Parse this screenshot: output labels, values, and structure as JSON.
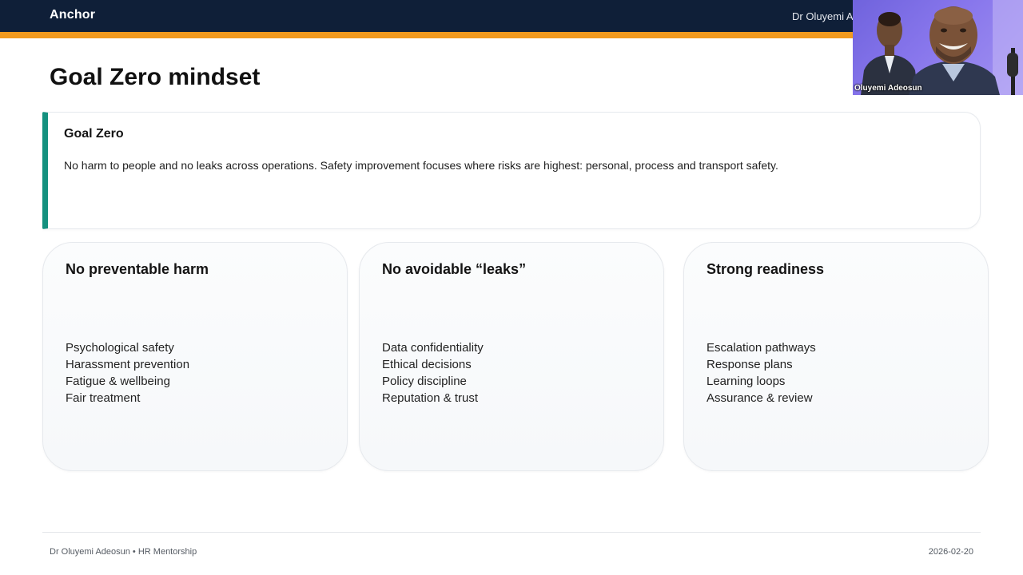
{
  "header": {
    "brand": "Anchor",
    "presenter": "Dr Oluyemi Adeosun",
    "colors": {
      "bar": "#0f1f38",
      "accent": "#f29a1e",
      "highlight": "#14917f"
    }
  },
  "slide": {
    "title": "Goal Zero mindset",
    "goal": {
      "heading": "Goal Zero",
      "text": "No harm to people and no leaks across operations. Safety improvement focuses where risks are highest: personal, process and transport safety."
    },
    "cards": [
      {
        "title": "No preventable harm",
        "items": [
          "Psychological safety",
          "Harassment prevention",
          "Fatigue & wellbeing",
          "Fair treatment"
        ]
      },
      {
        "title": "No avoidable “leaks”",
        "items": [
          "Data confidentiality",
          "Ethical decisions",
          "Policy discipline",
          "Reputation & trust"
        ]
      },
      {
        "title": "Strong readiness",
        "items": [
          "Escalation pathways",
          "Response plans",
          "Learning loops",
          "Assurance & review"
        ]
      }
    ]
  },
  "footer": {
    "left": "Dr Oluyemi Adeosun • HR Mentorship",
    "right": "2026-02-20"
  },
  "webcam": {
    "name": "Oluyemi Adeosun"
  }
}
